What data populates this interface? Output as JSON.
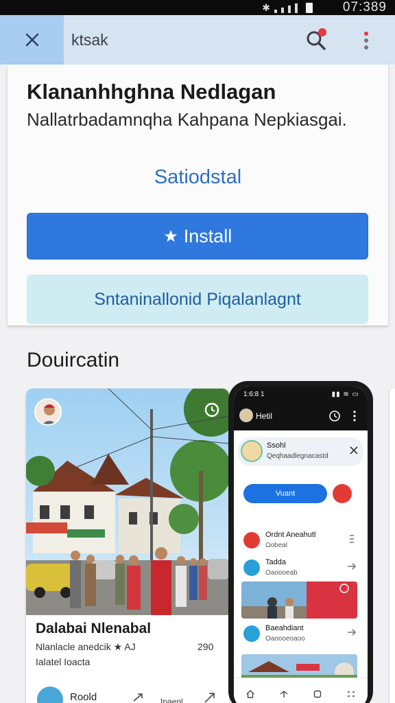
{
  "status_bar": {
    "time": "07:389"
  },
  "search": {
    "query": "ktsak"
  },
  "app": {
    "title": "Klananhhghna Nedlagan",
    "description": "Nallatrbadamnqha Kahpana Nepkiasgai.",
    "link": "Satiodstal",
    "install_label": "Install",
    "secondary_label": "Sntaninallonid Piqalanlagnt"
  },
  "section": {
    "title": "Douircatin"
  },
  "screenshot_card": {
    "title": "Dalabai Nlenabal",
    "subtitle": "Nlanlacle anedcik ★ AJ",
    "count": "290",
    "subtitle2": "Ialatel Ioacta",
    "footer_name": "Roold",
    "footer_text": "Ipaenl"
  },
  "phone": {
    "time": "1:6:8 1",
    "status_icons": "▮▮ ≋ ▭",
    "header_name": "Hetil",
    "notification": {
      "title": "Ssohl",
      "subtitle": "Qeqhaadlegnacastd"
    },
    "button_label": "Vuant",
    "rows": [
      {
        "title": "Ordnt Aneahutl",
        "sub": "Ωobeal"
      },
      {
        "title": "Tadda",
        "sub": "Oaoooeab"
      },
      {
        "title": "Baeahdiant",
        "sub": "Oaoooeoaoo"
      }
    ]
  },
  "colors": {
    "accent": "#2f78de",
    "close_button_bg": "#a8cdf0",
    "search_bar_bg": "#d6e3f1",
    "secondary_button_bg": "#cfecf2",
    "notification_dot": "#e8383c"
  },
  "icons": [
    "close-icon",
    "search-icon",
    "more-vert-icon",
    "star-icon",
    "share-icon",
    "clock-icon",
    "home-icon",
    "back-icon",
    "square-icon",
    "grid-icon"
  ]
}
